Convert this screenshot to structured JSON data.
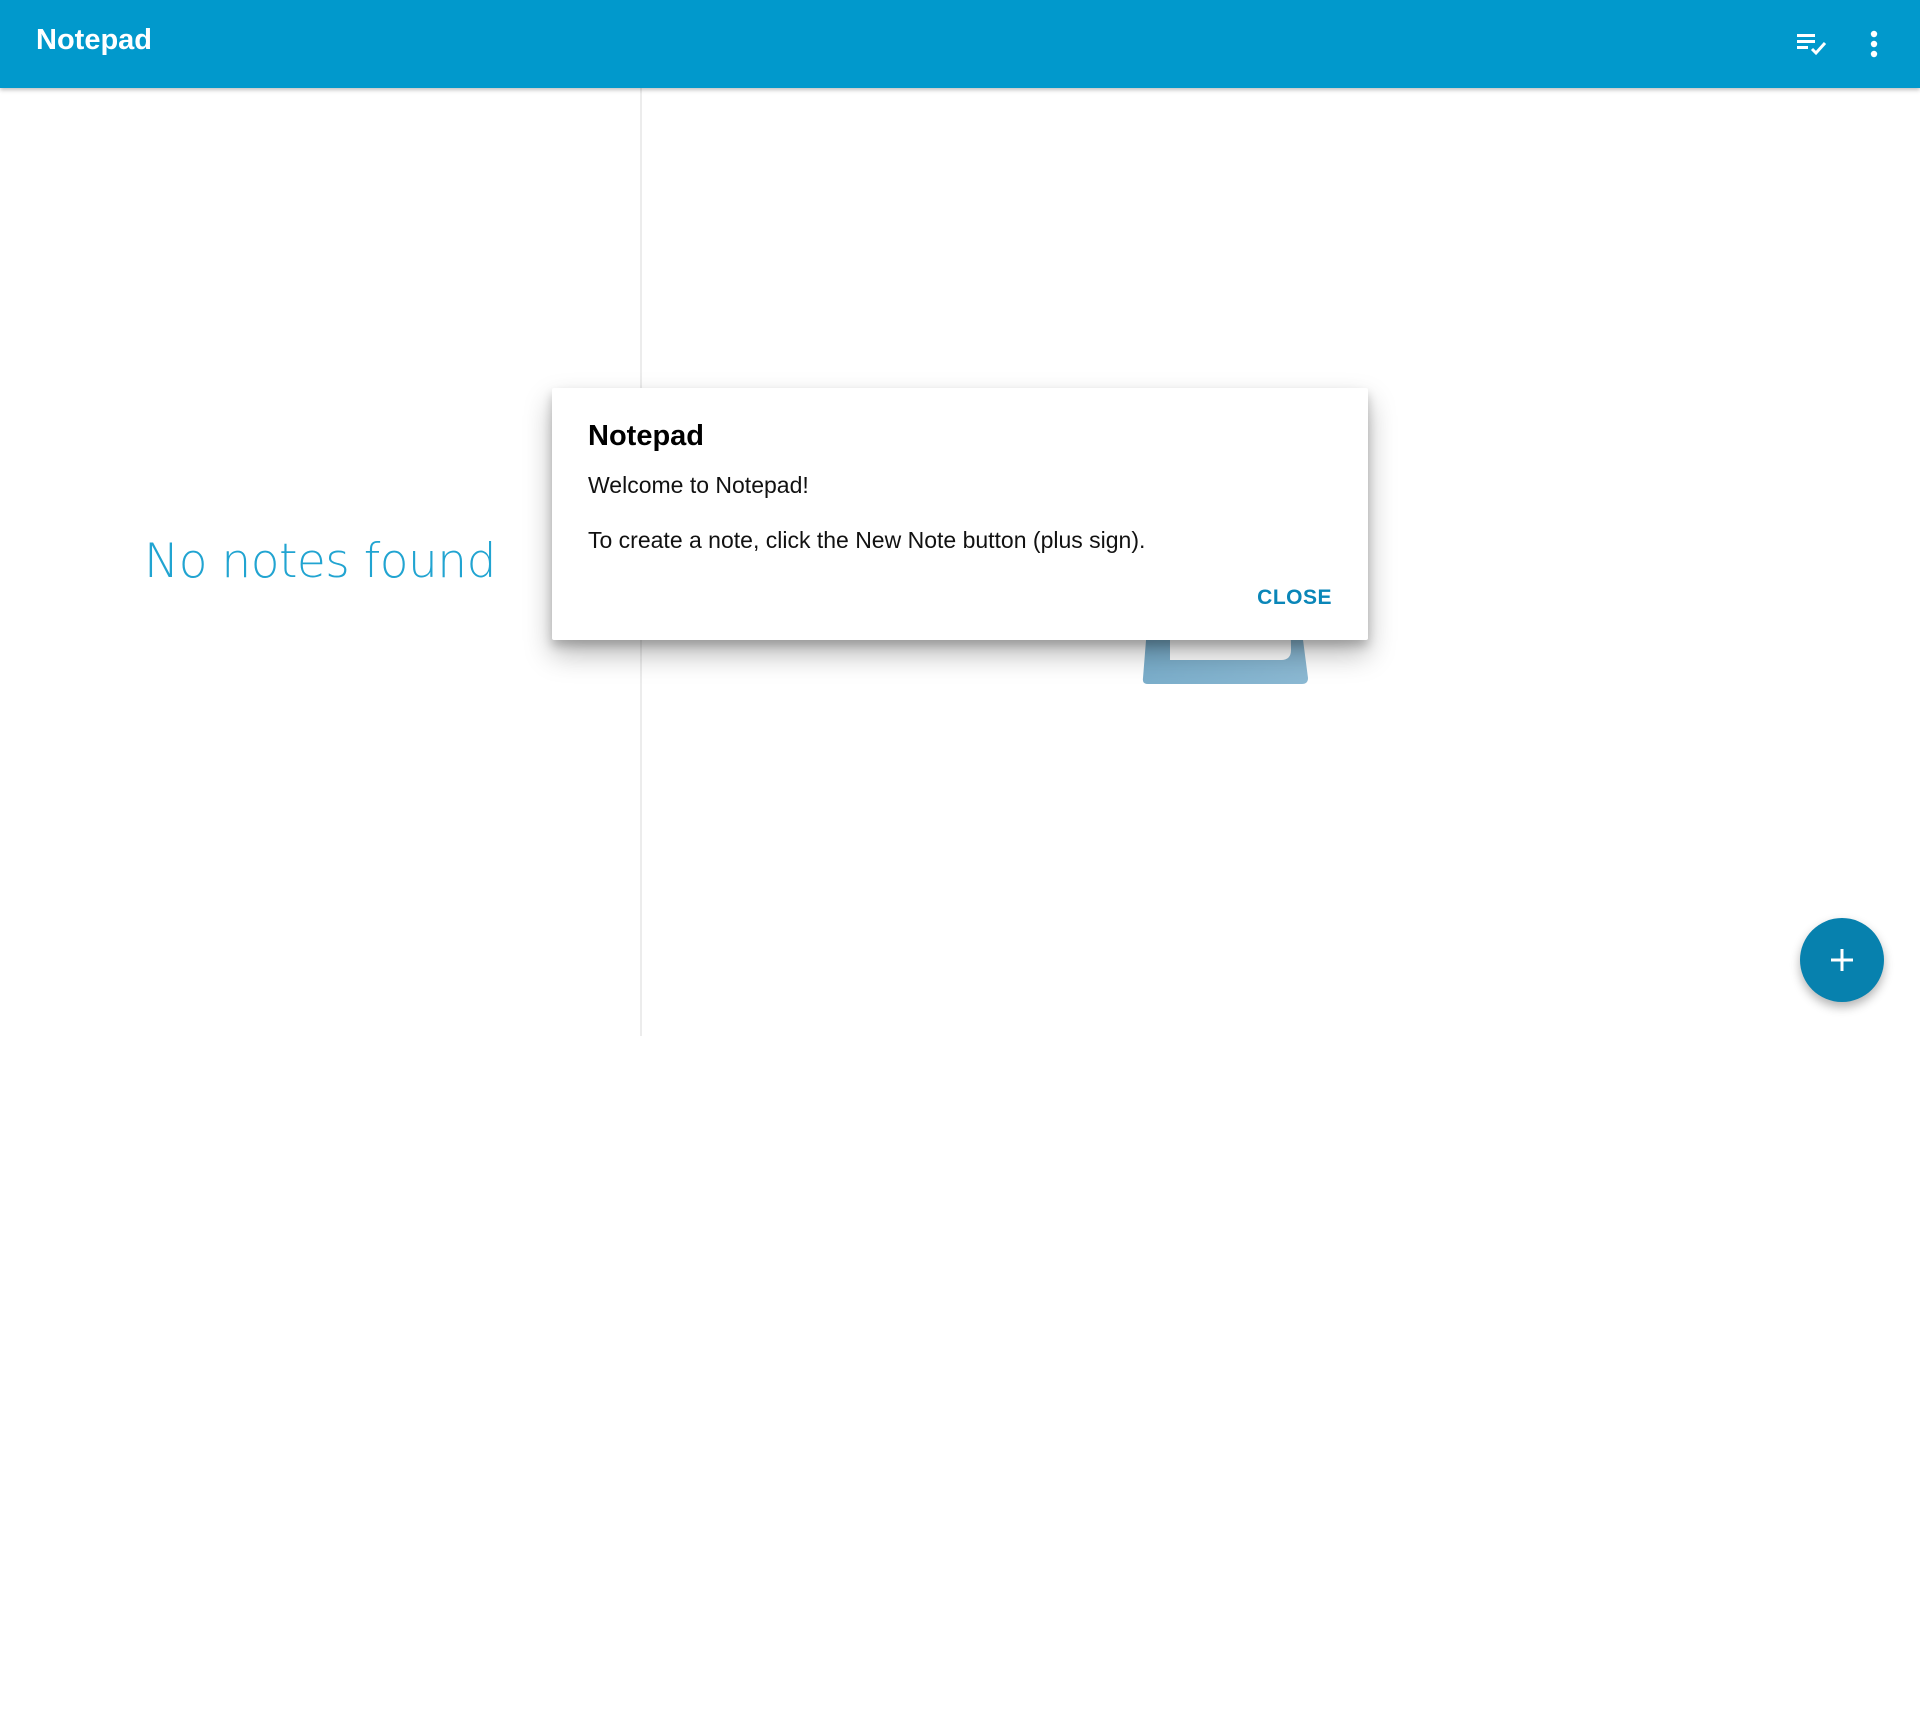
{
  "app_bar": {
    "title": "Notepad",
    "background_color": "#0199cc",
    "actions": [
      {
        "icon": "checklist-icon"
      },
      {
        "icon": "more-vert-icon"
      }
    ]
  },
  "note_list": {
    "empty_message": "No notes found"
  },
  "dialog": {
    "title": "Notepad",
    "lines": [
      "Welcome to Notepad!",
      "To create a note, click the New Note button (plus sign)."
    ],
    "close_label": "CLOSE",
    "accent_color": "#0a86b8"
  },
  "fab": {
    "icon": "plus-icon",
    "color": "#0781ae"
  },
  "empty_state_icon": "notepad-illustration-icon"
}
